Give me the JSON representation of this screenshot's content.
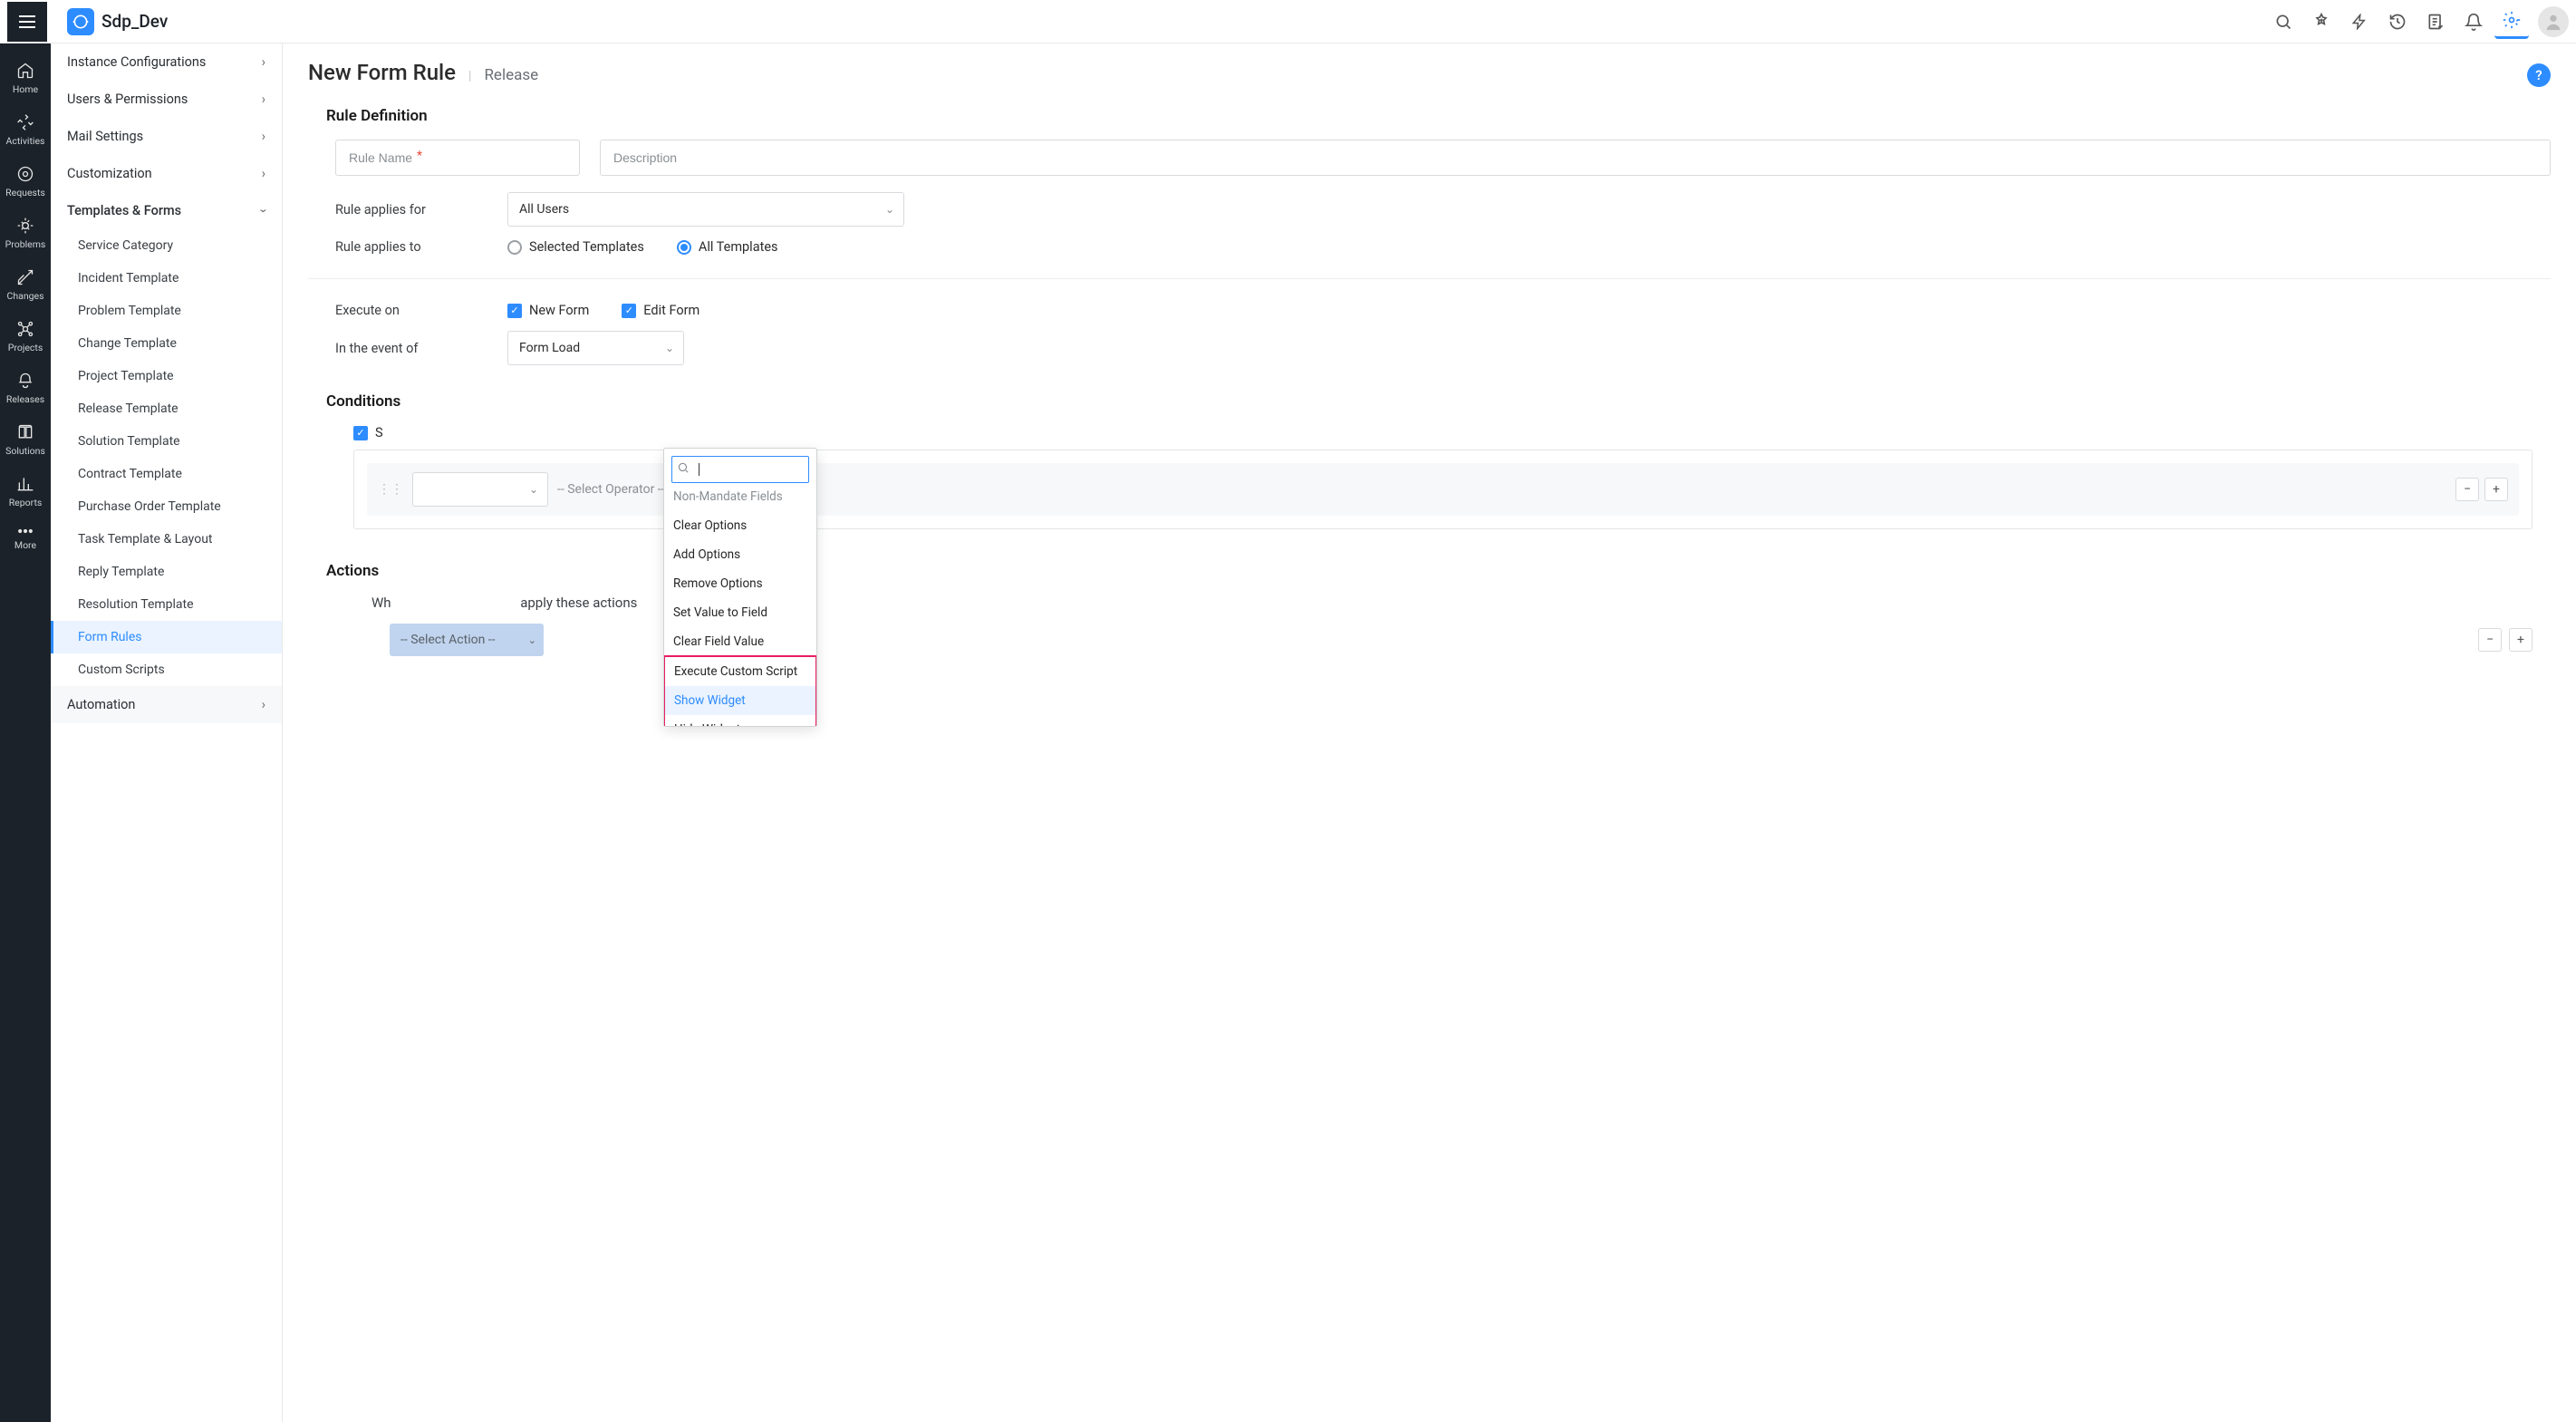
{
  "app": {
    "title": "Sdp_Dev"
  },
  "vnav": [
    {
      "label": "Home"
    },
    {
      "label": "Activities"
    },
    {
      "label": "Requests"
    },
    {
      "label": "Problems"
    },
    {
      "label": "Changes"
    },
    {
      "label": "Projects"
    },
    {
      "label": "Releases"
    },
    {
      "label": "Solutions"
    },
    {
      "label": "Reports"
    },
    {
      "label": "More"
    }
  ],
  "sidebar": {
    "groups": [
      {
        "label": "Instance Configurations"
      },
      {
        "label": "Users & Permissions"
      },
      {
        "label": "Mail Settings"
      },
      {
        "label": "Customization"
      },
      {
        "label": "Templates & Forms",
        "expanded": true
      },
      {
        "label": "Automation"
      }
    ],
    "templates_children": [
      "Service Category",
      "Incident Template",
      "Problem Template",
      "Change Template",
      "Project Template",
      "Release Template",
      "Solution Template",
      "Contract Template",
      "Purchase Order Template",
      "Task Template & Layout",
      "Reply Template",
      "Resolution Template",
      "Form Rules",
      "Custom Scripts"
    ],
    "active_child": "Form Rules"
  },
  "page": {
    "title": "New Form Rule",
    "subtitle": "Release",
    "section_rule_def": "Rule Definition",
    "rule_name_ph": "Rule Name",
    "description_ph": "Description",
    "applies_for_label": "Rule applies for",
    "applies_for_value": "All Users",
    "applies_to_label": "Rule applies to",
    "applies_to_opts": {
      "selected": "Selected Templates",
      "all": "All Templates"
    },
    "execute_label": "Execute on",
    "execute_opts": {
      "new": "New Form",
      "edit": "Edit Form"
    },
    "event_label": "In the event of",
    "event_value": "Form Load",
    "section_conditions": "Conditions",
    "cond_checkbox_partial": "S",
    "cond_operator_ph": "-- Select Operator --",
    "section_actions": "Actions",
    "action_sentence_pre": "Wh",
    "action_sentence_post": "apply these actions",
    "select_action_ph": "-- Select Action --"
  },
  "dropdown": {
    "cut_item": "Non-Mandate Fields",
    "items": [
      "Clear Options",
      "Add Options",
      "Remove Options",
      "Set Value to Field",
      "Clear Field Value",
      "Execute Custom Script",
      "Show Widget",
      "Hide Widget"
    ],
    "hover_item": "Show Widget"
  }
}
